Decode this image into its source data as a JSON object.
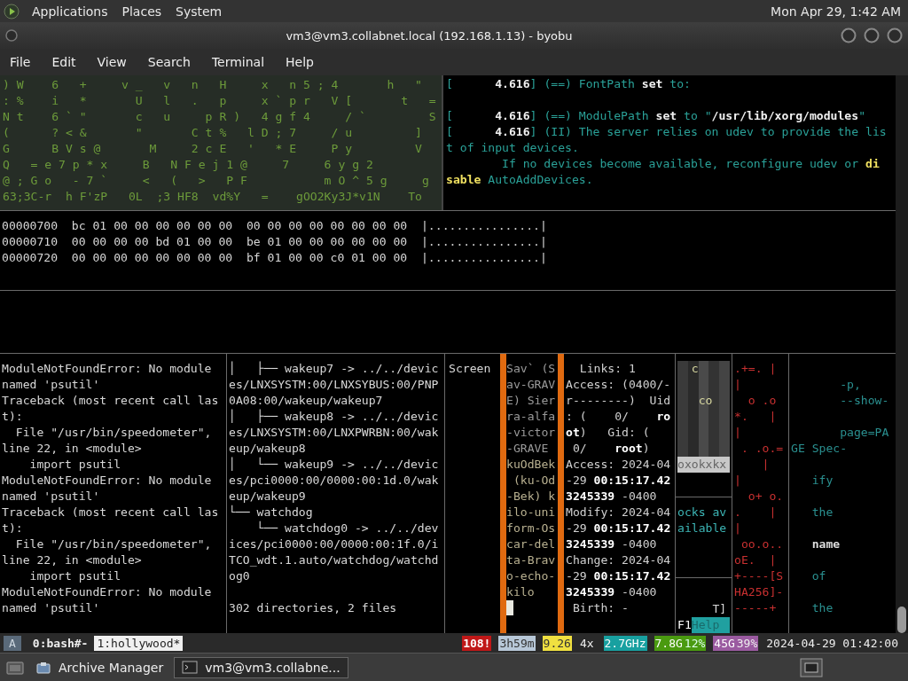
{
  "top_panel": {
    "menus": [
      {
        "label": "Applications"
      },
      {
        "label": "Places"
      },
      {
        "label": "System"
      }
    ],
    "clock": "Mon Apr 29, 1:42 AM"
  },
  "window": {
    "title": "vm3@vm3.collabnet.local (192.168.1.13) - byobu",
    "menu": [
      "File",
      "Edit",
      "View",
      "Search",
      "Terminal",
      "Help"
    ]
  },
  "terminal": {
    "rows": [
      {
        "kind": "top",
        "panes": [
          {
            "kind": "matrix",
            "active": false,
            "cursor": false,
            "lines": [
              ") W    6   +     v _   v   n   H     x   n 5 ; 4       h   \"",
              ": %    i   *       U   l   .   p     x ` p r   V [       t   =",
              "N t    6 ` \"       c   u     p R )   4 g f 4     / `         S",
              "(      ? < &       \"       C t %   l D ; 7     / u         ]",
              "G      B V s @       M     2 c E   '   * E     P y         V",
              "Q   = e 7 p * x     B   N F e j 1 @     7     6 y g 2",
              "@ ; G o   - 7 `     <   (   >   P F           m O ^ 5 g     g",
              "63;3C-r  h F'zP   0L  ;3 HF8  vd%Y   =    gOO2Ky3J*v1N    To"
            ]
          },
          {
            "kind": "log",
            "active": false,
            "cursor": false,
            "lines": [
              "[      **4.616**] (==) FontPath **set** to:",
              {
                "kind": "blank"
              },
              "[      **4.616**] (==) ModulePath **set** to \"**/usr/lib/xorg/modules**\"",
              "[      **4.616**] (II) The server relies on udev to provide the lis",
              "t of input devices.",
              {
                "kind": "warning",
                "text": "        If no devices become available, reconfigure udev or **di**"
              },
              {
                "kind": "warning",
                "text": "**sable** AutoAddDevices."
              }
            ]
          }
        ]
      },
      {
        "kind": "hex",
        "panes": [
          {
            "kind": "hex",
            "active": false,
            "cursor": false,
            "lines": [
              "00000700  bc 01 00 00 00 00 00 00  00 00 00 00 00 00 00 00  |................|",
              "00000710  00 00 00 00 bd 01 00 00  be 01 00 00 00 00 00 00  |................|",
              "00000720  00 00 00 00 00 00 00 00  bf 01 00 00 c0 01 00 00  |................|"
            ]
          }
        ]
      },
      {
        "kind": "bottom",
        "panes": [
          {
            "kind": "plain",
            "active": false,
            "cursor": false,
            "lines": [
              "ModuleNotFoundError: No module",
              "named 'psutil'",
              "Traceback (most recent call las",
              "t):",
              "  File \"/usr/bin/speedometer\",",
              "line 22, in <module>",
              "    import psutil",
              "ModuleNotFoundError: No module",
              "named 'psutil'",
              "Traceback (most recent call las",
              "t):",
              "  File \"/usr/bin/speedometer\",",
              "line 22, in <module>",
              "    import psutil",
              "ModuleNotFoundError: No module",
              "named 'psutil'"
            ]
          },
          {
            "kind": "plain",
            "active": false,
            "cursor": false,
            "lines": [
              "│   ├── wakeup7 -> ../../devic",
              "es/LNXSYSTM:00/LNXSYBUS:00/PNP",
              "0A08:00/wakeup/wakeup7",
              "│   ├── wakeup8 -> ../../devic",
              "es/LNXSYSTM:00/LNXPWRBN:00/wak",
              "eup/wakeup8",
              "│   └── wakeup9 -> ../../devic",
              "es/pci0000:00/0000:00:1d.0/wak",
              "eup/wakeup9",
              "└── watchdog",
              "    └── watchdog0 -> ../../dev",
              "ices/pci0000:00/0000:00:1f.0/i",
              "TCO_wdt.1.auto/watchdog/watchd",
              "og0",
              {
                "kind": "blank"
              },
              "302 directories, 2 files"
            ]
          },
          {
            "kind": "plain",
            "active": false,
            "cursor": false,
            "lines": [
              "Screen"
            ]
          },
          {
            "kind": "dim",
            "active": true,
            "cursor": true,
            "lines": [
              "Sav` (S",
              "av-GRAV",
              "E) Sier",
              "ra-alfa",
              "-victor",
              "-GRAVE",
              "kuOdBek",
              " (ku-Od",
              "-Bek) k",
              "ilo-uni",
              "form-Os",
              "car-del",
              "ta-Brav",
              "o-echo-",
              "kilo"
            ]
          },
          {
            "kind": "stat",
            "active": false,
            "cursor": false,
            "lines": [
              "  Links: 1",
              "Access: (0400/-",
              "r--------)  Uid",
              ": (    0/    **ro**",
              "**ot**)   Gid: (",
              " 0/    **root**)",
              "Access: 2024-04",
              {
                "kind": "time",
                "text": "-29 **00:15:17.42**"
              },
              {
                "kind": "time",
                "text": "**3245339** -0400"
              },
              "Modify: 2024-04",
              {
                "kind": "time",
                "text": "-29 **00:15:17.42**"
              },
              {
                "kind": "time",
                "text": "**3245339** -0400"
              },
              "Change: 2024-04",
              {
                "kind": "time",
                "text": "-29 **00:15:17.42**"
              },
              {
                "kind": "time",
                "text": "**3245339** -0400"
              },
              " Birth: -"
            ]
          },
          {
            "kind": "stack",
            "active": false,
            "cursor": false,
            "sections": [
              {
                "kind": "mosaic",
                "lines": [
                  "  c",
                  {
                    "kind": "blank"
                  },
                  "   co",
                  {
                    "kind": "blank"
                  },
                  {
                    "kind": "blank"
                  },
                  {
                    "kind": "blank"
                  },
                  "oxokxkx"
                ]
              },
              {
                "kind": "text",
                "lines": [
                  "ocks av",
                  "ailable"
                ]
              },
              {
                "kind": "help",
                "lines": [
                  "     T]"
                ],
                "key": "F1",
                "label": "Help"
              }
            ]
          },
          {
            "kind": "art",
            "active": false,
            "cursor": false,
            "lines": [
              ".+=. |",
              "|",
              "  o .o",
              "*.   |",
              "|",
              " . .o.=",
              "    |",
              "|",
              "  o+ o.",
              ".    |",
              "|",
              " oo.o..",
              "oE.  |",
              "+----[S",
              "HA256]-",
              "-----+"
            ]
          },
          {
            "kind": "man",
            "active": false,
            "cursor": false,
            "lines": [
              {
                "kind": "blank"
              },
              "       -p,",
              "       --show-",
              {
                "kind": "blank"
              },
              "       page=PA",
              "GE Spec-",
              {
                "kind": "blank"
              },
              "   ify",
              {
                "kind": "blank"
              },
              "   the",
              {
                "kind": "blank"
              },
              "   **name**",
              {
                "kind": "blank"
              },
              "   of",
              {
                "kind": "blank"
              },
              "   the"
            ]
          }
        ]
      }
    ]
  },
  "status_bar": {
    "session": "A",
    "windows": [
      {
        "label": "0:bash#-",
        "selected": false
      },
      {
        "label": "1:hollywood*",
        "selected": true
      }
    ],
    "stats": [
      {
        "parts": [
          {
            "text": "108!",
            "kind": "red"
          }
        ]
      },
      {
        "parts": [
          {
            "text": "3h59m",
            "kind": "slate"
          }
        ]
      },
      {
        "parts": [
          {
            "text": "9.26",
            "kind": "yellow"
          }
        ]
      },
      {
        "parts": [
          {
            "text": "4x",
            "kind": "plain"
          },
          {
            "text": "2.7GHz",
            "kind": "teal"
          }
        ]
      },
      {
        "parts": [
          {
            "text": "7.8G",
            "kind": "green"
          },
          {
            "text": "12%",
            "kind": "lime"
          }
        ]
      },
      {
        "parts": [
          {
            "text": "45G",
            "kind": "purple"
          },
          {
            "text": "39%",
            "kind": "violet"
          }
        ]
      },
      {
        "parts": [
          {
            "text": "2024-04-29 01:42:00",
            "kind": "plain"
          }
        ]
      }
    ]
  },
  "taskbar": {
    "items": [
      {
        "label": "Archive Manager",
        "kind": "archive",
        "selected": false
      },
      {
        "label": "vm3@vm3.collabne...",
        "kind": "terminal",
        "selected": true
      }
    ]
  }
}
